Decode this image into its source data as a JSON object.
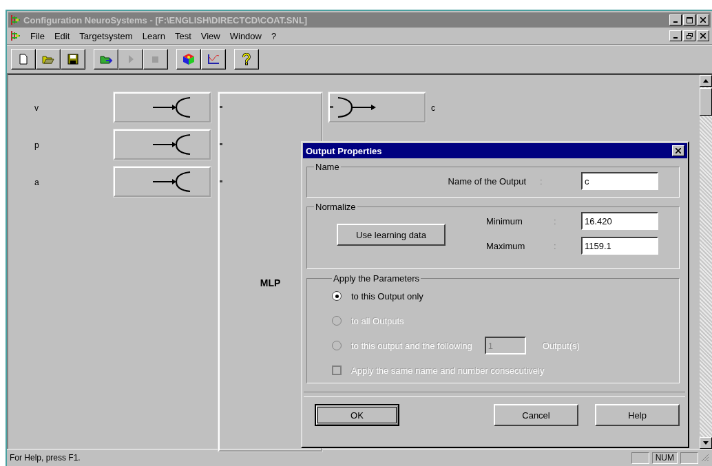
{
  "window": {
    "title": "Configuration NeuroSystems - [F:\\ENGLISH\\DIRECTCD\\COAT.SNL]",
    "active": false
  },
  "menu": [
    {
      "label": "File"
    },
    {
      "label": "Edit"
    },
    {
      "label": "Targetsystem"
    },
    {
      "label": "Learn"
    },
    {
      "label": "Test"
    },
    {
      "label": "View"
    },
    {
      "label": "Window"
    },
    {
      "label": "?"
    }
  ],
  "toolbar": [
    [
      {
        "kind": "new",
        "disabled": false
      },
      {
        "kind": "open",
        "disabled": false
      },
      {
        "kind": "save",
        "disabled": false
      }
    ],
    [
      {
        "kind": "load",
        "disabled": false
      },
      {
        "kind": "play",
        "disabled": true
      },
      {
        "kind": "stop",
        "disabled": true
      }
    ],
    [
      {
        "kind": "cube",
        "disabled": false
      },
      {
        "kind": "graph",
        "disabled": false
      }
    ],
    [
      {
        "kind": "help",
        "disabled": false
      }
    ]
  ],
  "diagram": {
    "inputs": [
      {
        "label": "v"
      },
      {
        "label": "p"
      },
      {
        "label": "a"
      }
    ],
    "network": {
      "label": "MLP"
    },
    "outputs": [
      {
        "label": "c"
      }
    ]
  },
  "dialog": {
    "title": "Output Properties",
    "name_group": {
      "legend": "Name",
      "label": "Name of the Output",
      "separator": ":",
      "value": "c"
    },
    "normalize_group": {
      "legend": "Normalize",
      "button": "Use learning data",
      "minimum": {
        "label": "Minimum",
        "separator": ":",
        "value": "16.420"
      },
      "maximum": {
        "label": "Maximum",
        "separator": ":",
        "value": "1159.1"
      }
    },
    "apply_group": {
      "legend": "Apply the Parameters",
      "options": [
        {
          "label": "to this Output only",
          "selected": true,
          "disabled": false
        },
        {
          "label": "to all Outputs",
          "selected": false,
          "disabled": true
        },
        {
          "label": "to this output and the following",
          "selected": false,
          "disabled": true,
          "count": "1",
          "suffix": "Output(s)"
        }
      ],
      "checkbox": {
        "label": "Apply the same name and number consecutively",
        "checked": false,
        "disabled": true
      }
    },
    "buttons": [
      {
        "label": "OK",
        "default": true
      },
      {
        "label": "Cancel",
        "default": false
      },
      {
        "label": "Help",
        "default": false
      }
    ]
  },
  "status_bar": {
    "text": "For Help, press F1.",
    "indicators": [
      "NUM"
    ]
  }
}
